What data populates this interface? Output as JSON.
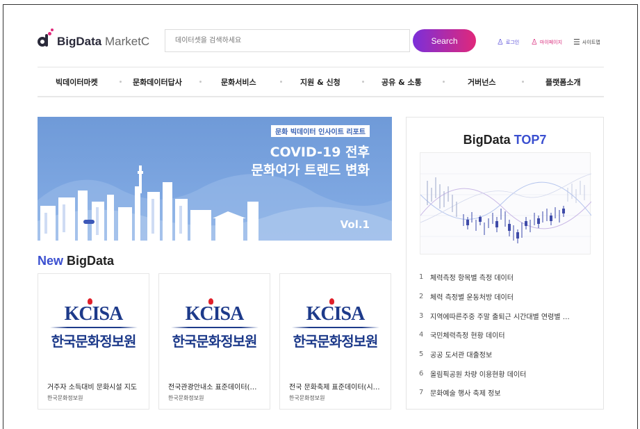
{
  "header": {
    "logo_bold": "BigData",
    "logo_light": "MarketC",
    "search_placeholder": "데이터셋을 검색하세요",
    "search_button": "Search",
    "login": "로그인",
    "mypage": "마이페이지",
    "sitemap": "사이트맵"
  },
  "nav": {
    "items": [
      "빅데이터마켓",
      "문화데이터답사",
      "문화서비스",
      "지원 & 신청",
      "공유 & 소통",
      "거버넌스",
      "플랫폼소개"
    ]
  },
  "banner": {
    "tag": "문화 빅데이터 인사이트 리포트",
    "title_line1": "COVID-19 전후",
    "title_line2": "문화여가 트렌드 변화",
    "vol": "Vol.1"
  },
  "new_bigdata": {
    "title_accent": "New",
    "title_rest": "BigData",
    "cards": [
      {
        "logo_en": "KCISA",
        "logo_kr": "한국문화정보원",
        "name": "거주자 소득대비 문화시설 지도",
        "org": "한국문화정보원"
      },
      {
        "logo_en": "KCISA",
        "logo_kr": "한국문화정보원",
        "name": "전국관광안내소 표준데이터(…",
        "org": "한국문화정보원"
      },
      {
        "logo_en": "KCISA",
        "logo_kr": "한국문화정보원",
        "name": "전국 문화축제 표준데이터(시…",
        "org": "한국문화정보원"
      }
    ]
  },
  "top7": {
    "title_plain": "BigData",
    "title_accent": "TOP7",
    "items": [
      {
        "rank": "1",
        "title": "체력측정 항목별 측정 데이터"
      },
      {
        "rank": "2",
        "title": "체력 측정별 운동처방 데이터"
      },
      {
        "rank": "3",
        "title": "지역에따른주중 주말 출퇴근 시간대별 연령별 …"
      },
      {
        "rank": "4",
        "title": "국민체력측정 현황 데이터"
      },
      {
        "rank": "5",
        "title": "공공 도서관 대출정보"
      },
      {
        "rank": "6",
        "title": "올림픽공원 차량 이용현황 데이터"
      },
      {
        "rank": "7",
        "title": "문화예술 행사 축제 정보"
      }
    ]
  },
  "colors": {
    "accent_blue": "#3a4fd0",
    "gradient_start": "#7b2fd9",
    "gradient_end": "#e0287a",
    "banner_bg": "#7aa4df",
    "kcisa_navy": "#1d3a8a"
  }
}
